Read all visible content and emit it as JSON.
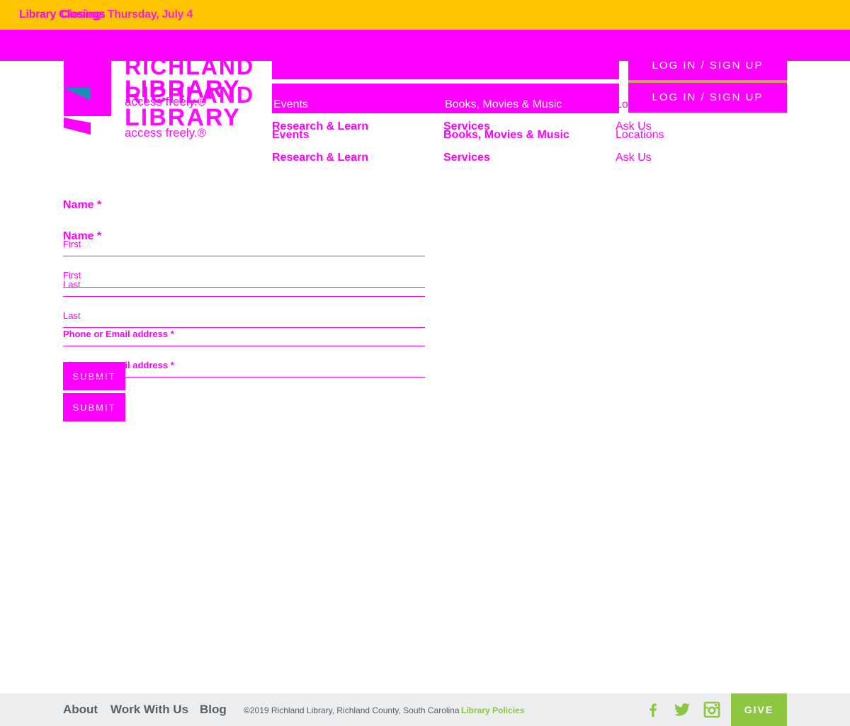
{
  "alert": {
    "text_a": "Library Closings",
    "text_b": "Closing: Thursday, July 4"
  },
  "header": {
    "logo_line1": "RICHLAND",
    "logo_line2": "LIBRARY",
    "logo_tagline": "access freely.®",
    "login_label": "LOG IN / SIGN UP"
  },
  "nav": {
    "events": "Events",
    "research": "Research & Learn",
    "books": "Books, Movies & Music",
    "services": "Services",
    "locations": "Locations",
    "ask": "Ask Us"
  },
  "form": {
    "name_label": "Name *",
    "first_label": "First",
    "last_label": "Last",
    "contact_label": "Phone or Email address *",
    "submit_label": "SUBMIT"
  },
  "footer": {
    "about": "About",
    "work": "Work With Us",
    "blog": "Blog",
    "copyright": "©2019 Richland Library, Richland County, South Carolina",
    "policies": "Library Policies",
    "give": "GIVE"
  },
  "colors": {
    "alert_bg": "#ffc600",
    "accent": "#ff00ff",
    "footer_bg": "#ebedef",
    "footer_text": "#5a5f65",
    "green": "#8dc63f",
    "gold": "#c8a84b"
  },
  "icons": [
    "facebook-icon",
    "twitter-icon",
    "instagram-icon"
  ]
}
